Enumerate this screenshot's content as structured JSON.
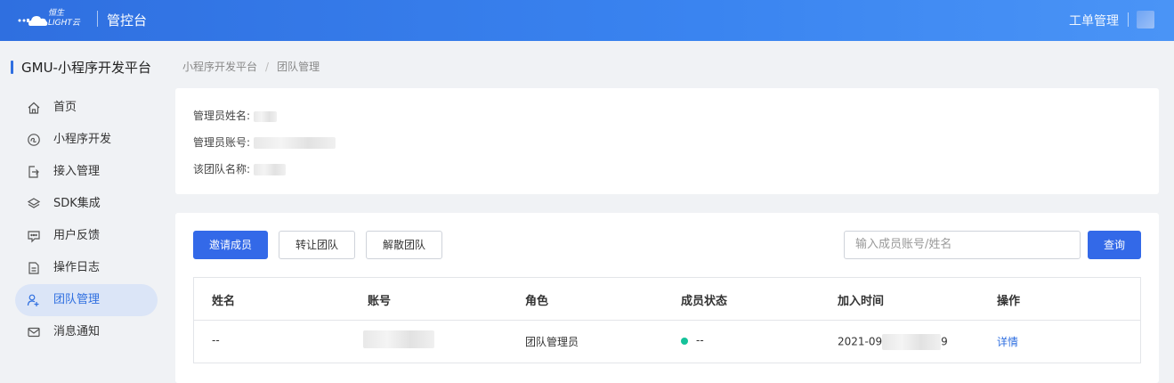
{
  "header": {
    "logo_text_line1": "恒生",
    "logo_text_line2": "LIGHT云",
    "title": "管控台",
    "right_link": "工单管理"
  },
  "sidebar": {
    "app_title": "GMU-小程序开发平台",
    "items": [
      {
        "label": "首页",
        "icon": "home-icon"
      },
      {
        "label": "小程序开发",
        "icon": "miniprogram-icon"
      },
      {
        "label": "接入管理",
        "icon": "access-icon"
      },
      {
        "label": "SDK集成",
        "icon": "layers-icon"
      },
      {
        "label": "用户反馈",
        "icon": "feedback-icon"
      },
      {
        "label": "操作日志",
        "icon": "document-icon"
      },
      {
        "label": "团队管理",
        "icon": "team-icon",
        "active": true
      },
      {
        "label": "消息通知",
        "icon": "mail-icon"
      }
    ]
  },
  "breadcrumb": {
    "parent": "小程序开发平台",
    "separator": "/",
    "current": "团队管理"
  },
  "team_info": {
    "admin_name_label": "管理员姓名:",
    "admin_account_label": "管理员账号:",
    "team_name_label": "该团队名称:"
  },
  "actions": {
    "invite": "邀请成员",
    "transfer": "转让团队",
    "dissolve": "解散团队",
    "search_placeholder": "输入成员账号/姓名",
    "query": "查询"
  },
  "table": {
    "columns": [
      "姓名",
      "账号",
      "角色",
      "成员状态",
      "加入时间",
      "操作"
    ],
    "rows": [
      {
        "name": "--",
        "role": "团队管理员",
        "status": "--",
        "join_time_prefix": "2021-09",
        "join_time_suffix": "9",
        "action": "详情"
      }
    ]
  },
  "colors": {
    "primary": "#3369e8",
    "status_active": "#15c29a"
  }
}
